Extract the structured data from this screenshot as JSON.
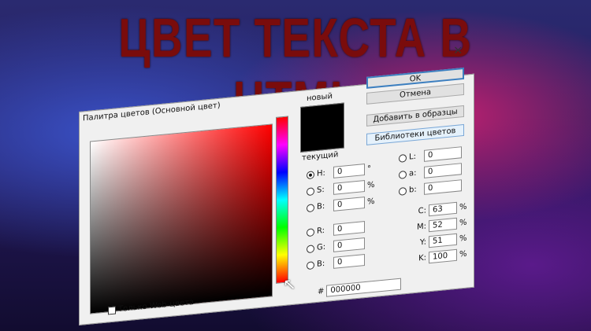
{
  "headline": "ЦВЕТ ТЕКСТА В HTML",
  "dialog": {
    "title": "Палитра цветов (Основной цвет)",
    "close_icon": "×",
    "new_label": "новый",
    "current_label": "текущий",
    "buttons": {
      "ok": "OK",
      "cancel": "Отмена",
      "add": "Добавить в образцы",
      "libraries": "Библиотеки цветов"
    },
    "hsb": [
      {
        "label": "H:",
        "value": "0",
        "unit": "°",
        "selected": true
      },
      {
        "label": "S:",
        "value": "0",
        "unit": "%"
      },
      {
        "label": "B:",
        "value": "0",
        "unit": "%"
      }
    ],
    "rgb": [
      {
        "label": "R:",
        "value": "0"
      },
      {
        "label": "G:",
        "value": "0"
      },
      {
        "label": "B:",
        "value": "0"
      }
    ],
    "lab": [
      {
        "label": "L:",
        "value": "0"
      },
      {
        "label": "a:",
        "value": "0"
      },
      {
        "label": "b:",
        "value": "0"
      }
    ],
    "cmyk": [
      {
        "label": "C:",
        "value": "63",
        "unit": "%"
      },
      {
        "label": "M:",
        "value": "52",
        "unit": "%"
      },
      {
        "label": "Y:",
        "value": "51",
        "unit": "%"
      },
      {
        "label": "K:",
        "value": "100",
        "unit": "%"
      }
    ],
    "hex_label": "#",
    "hex": "000000",
    "web_only": "Только Web-цвета"
  }
}
